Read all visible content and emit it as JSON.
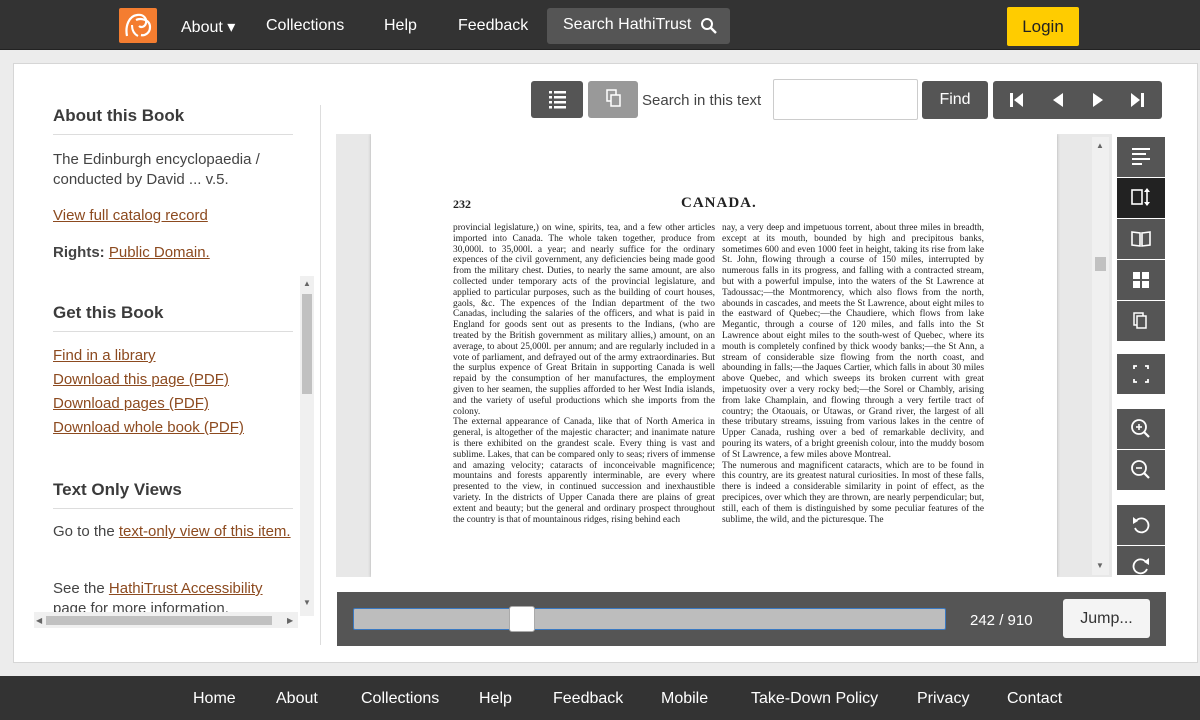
{
  "topnav": {
    "about": "About ▾",
    "collections": "Collections",
    "help": "Help",
    "feedback": "Feedback",
    "search": "Search HathiTrust",
    "login": "Login"
  },
  "sidebar": {
    "about_heading": "About this Book",
    "book_title": "The Edinburgh encyclopaedia / conducted by David ... v.5.",
    "catalog_link": "View full catalog record",
    "rights_label": "Rights:",
    "rights_value": "Public Domain.",
    "get_heading": "Get this Book",
    "get_links": [
      "Find in a library",
      "Download this page (PDF)",
      "Download pages (PDF)",
      "Download whole book (PDF)"
    ],
    "text_heading": "Text Only Views",
    "text_only_pre": "Go to the ",
    "text_only_link": "text-only view of this item.",
    "accessibility_pre": "See the ",
    "accessibility_link": "HathiTrust Accessibility",
    "accessibility_post": " page for more information."
  },
  "toolbar": {
    "search_label": "Search in this text",
    "search_value": "",
    "find": "Find"
  },
  "page": {
    "number": "232",
    "heading": "CANADA.",
    "col1": "provincial legislature,) on wine, spirits, tea, and a few other articles imported into Canada. The whole taken together, produce from 30,000l. to 35,000l. a year; and nearly suffice for the ordinary expences of the civil government, any deficiencies being made good from the military chest. Duties, to nearly the same amount, are also collected under temporary acts of the provincial legislature, and applied to particular purposes, such as the building of court houses, gaols, &c. The expences of the Indian department of the two Canadas, including the salaries of the officers, and what is paid in England for goods sent out as presents to the Indians, (who are treated by the British government as military allies,) amount, on an average, to about 25,000l. per annum; and are regularly included in a vote of parliament, and defrayed out of the army extraordinaries. But the surplus expence of Great Britain in supporting Canada is well repaid by the consumption of her manufactures, the employment given to her seamen, the supplies afforded to her West India islands, and the variety of useful productions which she imports from the colony.\n   The external appearance of Canada, like that of North America in general, is altogether of the majestic character; and inanimate nature is there exhibited on the grandest scale. Every thing is vast and sublime. Lakes, that can be compared only to seas; rivers of immense and amazing velocity; cataracts of inconceivable magnificence; mountains and forests apparently interminable, are every where presented to the view, in continued succession and inexhaustible variety. In the districts of Upper Canada there are plains of great extent and beauty; but the general and ordinary prospect throughout the country is that of mountainous ridges, rising behind each",
    "col2": "nay, a very deep and impetuous torrent, about three miles in breadth, except at its mouth, bounded by high and precipitous banks, sometimes 600 and even 1000 feet in height, taking its rise from lake St. John, flowing through a course of 150 miles, interrupted by numerous falls in its progress, and falling with a contracted stream, but with a powerful impulse, into the waters of the St Lawrence at Tadoussac;—the Montmorency, which also flows from the north, abounds in cascades, and meets the St Lawrence, about eight miles to the eastward of Quebec;—the Chaudiere, which flows from lake Megantic, through a course of 120 miles, and falls into the St Lawrence about eight miles to the south-west of Quebec, where its mouth is completely confined by thick woody banks;—the St Ann, a stream of considerable size flowing from the north coast, and abounding in falls;—the Jaques Cartier, which falls in about 30 miles above Quebec, and which sweeps its broken current with great impetuosity over a very rocky bed;—the Sorel or Chambly, arising from lake Champlain, and flowing through a very fertile tract of country; the Otaouais, or Utawas, or Grand river, the largest of all these tributary streams, issuing from various lakes in the centre of Upper Canada, rushing over a bed of remarkable declivity, and pouring its waters, of a bright greenish colour, into the muddy bosom of St Lawrence, a few miles above Montreal.\n   The numerous and magnificent cataracts, which are to be found in this country, are its greatest natural curiosities. In most of these falls, there is indeed a considerable similarity in point of effect, as the precipices, over which they are thrown, are nearly perpendicular; but, still, each of them is distinguished by some peculiar features of the sublime, the wild, and the picturesque. The"
  },
  "pagination": {
    "current": 242,
    "total": 910,
    "label": "242 / 910",
    "jump": "Jump..."
  },
  "footer": [
    "Home",
    "About",
    "Collections",
    "Help",
    "Feedback",
    "Mobile",
    "Take-Down Policy",
    "Privacy",
    "Contact"
  ],
  "colors": {
    "nav_bg": "#333333",
    "accent_orange": "#f47d30",
    "login_yellow": "#ffcc00",
    "link_brown": "#8c4a1f",
    "button_gray": "#555555"
  }
}
